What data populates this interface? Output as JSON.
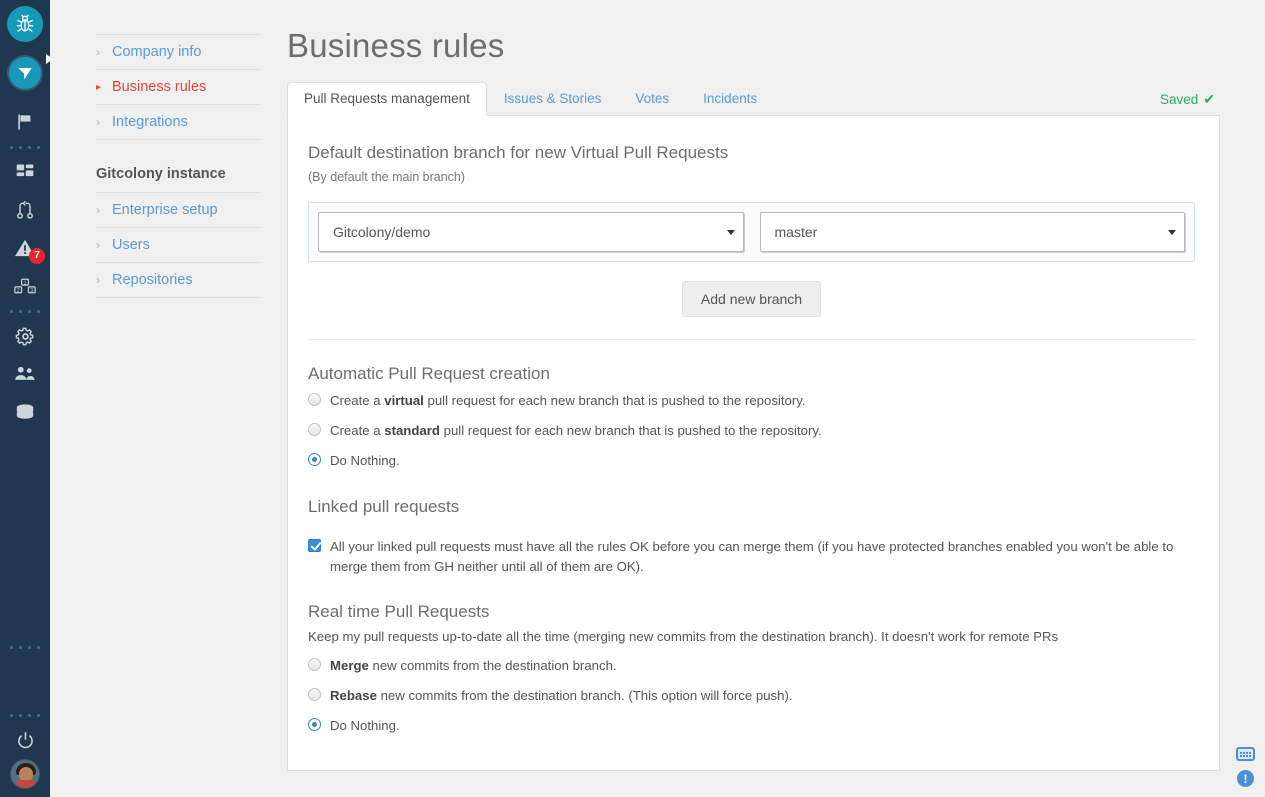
{
  "rail": {
    "logo_primary_icon": "bug-icon",
    "logo_secondary_icon": "paper-plane-icon",
    "expand_caret_icon": "caret-right-icon",
    "items": [
      {
        "icon": "flag-icon",
        "name": "rail-item-flag"
      },
      {
        "icon": "dashboard-grid-icon",
        "name": "rail-item-dashboard"
      },
      {
        "icon": "pull-request-icon",
        "name": "rail-item-pull-requests"
      },
      {
        "icon": "warning-triangle-icon",
        "name": "rail-item-alerts",
        "badge": "7"
      },
      {
        "icon": "blocks-123-icon",
        "name": "rail-item-blocks"
      },
      {
        "icon": "gear-icon",
        "name": "rail-item-settings"
      },
      {
        "icon": "users-icon",
        "name": "rail-item-users"
      },
      {
        "icon": "database-icon",
        "name": "rail-item-database"
      }
    ],
    "power_icon": "power-icon",
    "avatar": "user-avatar"
  },
  "sidebar": {
    "group_one": [
      {
        "label": "Company info",
        "active": false
      },
      {
        "label": "Business rules",
        "active": true
      },
      {
        "label": "Integrations",
        "active": false
      }
    ],
    "section_title": "Gitcolony instance",
    "group_two": [
      {
        "label": "Enterprise setup",
        "active": false
      },
      {
        "label": "Users",
        "active": false
      },
      {
        "label": "Repositories",
        "active": false
      }
    ]
  },
  "header": {
    "title": "Business rules"
  },
  "tabs": {
    "items": [
      {
        "label": "Pull Requests management",
        "active": true
      },
      {
        "label": "Issues & Stories",
        "active": false
      },
      {
        "label": "Votes",
        "active": false
      },
      {
        "label": "Incidents",
        "active": false
      }
    ],
    "saved_label": "Saved",
    "saved_check": "✔",
    "saved_color": "#27ae60"
  },
  "destination": {
    "heading": "Default destination branch for new Virtual Pull Requests",
    "subtext": "(By default the main branch)",
    "repo_select_value": "Gitcolony/demo",
    "branch_select_value": "master",
    "add_branch_button": "Add new branch"
  },
  "auto_pr": {
    "heading": "Automatic Pull Request creation",
    "options": [
      {
        "pre": "Create a ",
        "strong": "virtual",
        "post": " pull request for each new branch that is pushed to the repository.",
        "selected": false
      },
      {
        "pre": "Create a ",
        "strong": "standard",
        "post": " pull request for each new branch that is pushed to the repository.",
        "selected": false
      },
      {
        "pre": "",
        "strong": "",
        "post": "Do Nothing.",
        "selected": true
      }
    ]
  },
  "linked_pr": {
    "heading": "Linked pull requests",
    "checkbox_checked": true,
    "checkbox_label": "All your linked pull requests must have all the rules OK before you can merge them (if you have protected branches enabled you won't be able to merge them from GH neither until all of them are OK)."
  },
  "realtime_pr": {
    "heading": "Real time Pull Requests",
    "note": "Keep my pull requests up-to-date all the time (merging new commits from the destination branch). It doesn't work for remote PRs",
    "options": [
      {
        "pre": "",
        "strong": "Merge",
        "post": " new commits from the destination branch.",
        "selected": false
      },
      {
        "pre": "",
        "strong": "Rebase",
        "post": " new commits from the destination branch. (This option will force push).",
        "selected": false
      },
      {
        "pre": "",
        "strong": "",
        "post": "Do Nothing.",
        "selected": true
      }
    ]
  },
  "corner": {
    "keyboard_icon": "keyboard-icon",
    "info_icon": "info-circle-icon",
    "info_glyph": "!"
  },
  "colors": {
    "rail_bg": "#1f3850",
    "accent_teal": "#1799ba",
    "link_blue": "#5b9bd5",
    "active_red": "#e8433a",
    "badge_red": "#e8262b",
    "page_bg": "#f0f0f0"
  }
}
